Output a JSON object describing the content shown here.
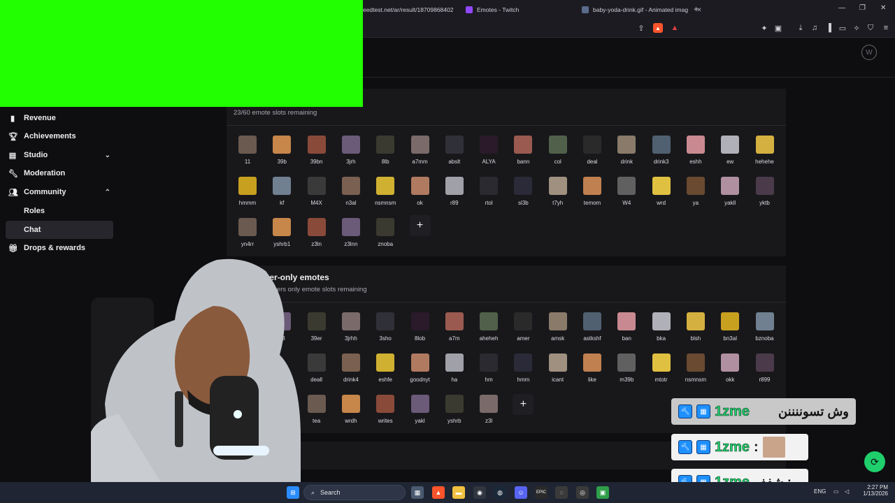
{
  "browser": {
    "tabs": [
      {
        "title": "speedtest.net/ar/result/18709868402"
      },
      {
        "title": "Emotes - Twitch"
      },
      {
        "title": "baby-yoda-drink.gif - Animated imag"
      }
    ],
    "new_tab": "+",
    "window_controls": [
      "—",
      "❐",
      "✕"
    ]
  },
  "sidebar": {
    "items": [
      {
        "label": "Revenue",
        "icon": "dollar-icon"
      },
      {
        "label": "Achievements",
        "icon": "trophy-icon"
      },
      {
        "label": "Studio",
        "icon": "video-icon"
      },
      {
        "label": "Moderation",
        "icon": "wrench-icon"
      },
      {
        "label": "Community",
        "icon": "people-icon"
      },
      {
        "label": "Roles"
      },
      {
        "label": "Chat"
      },
      {
        "label": "Drops & rewards",
        "icon": "gift-icon"
      }
    ]
  },
  "follower_panel": {
    "slots": "23/60 emote slots remaining",
    "emotes": [
      "11",
      "39b",
      "39bn",
      "3jrh",
      "8lb",
      "a7mm",
      "abslt",
      "ALYA",
      "bann",
      "col",
      "deal",
      "drink",
      "drink3",
      "eshh",
      "ew",
      "hehehe",
      "hmmm",
      "kf",
      "M4X",
      "n3al",
      "nsmnsm",
      "ok",
      "r89",
      "rtol",
      "sl3b",
      "t7yh",
      "temom",
      "W4",
      "wrd",
      "ya",
      "yakll",
      "yktb",
      "yn4rr",
      "yshrb1",
      "z3ln",
      "z3lnn",
      "znoba"
    ],
    "add": "+"
  },
  "subscriber_panel": {
    "title": "Subscriber-only emotes",
    "slots": "21/60 subscribers only emote slots remaining",
    "row1": [
      "23",
      "39er",
      "3jrhh",
      "3sho",
      "8lob",
      "a7m",
      "aheheh",
      "amer",
      "amsk",
      "astkshf",
      "ban",
      "bka",
      "blsh",
      "bn3al",
      "bznoba"
    ],
    "row2": [
      "deall",
      "drink4",
      "eshfe",
      "goodnyt",
      "ha",
      "hm",
      "hmm",
      "icant",
      "like",
      "m39b",
      "mtotr",
      "nsmnsm",
      "okk",
      "r899"
    ],
    "row3": [
      "tea",
      "wrdh",
      "writes",
      "yakl",
      "yshrb",
      "z3l"
    ],
    "add": "+"
  },
  "chat_overlay": [
    {
      "user": "1zme",
      "text": "وش تسوننننن"
    },
    {
      "user": "1zme",
      "text": ":"
    },
    {
      "user": "1zme",
      "text": "شفف :"
    }
  ],
  "taskbar": {
    "search": "Search",
    "lang": "ENG",
    "time": "2:27 PM",
    "date": "1/13/2026"
  }
}
